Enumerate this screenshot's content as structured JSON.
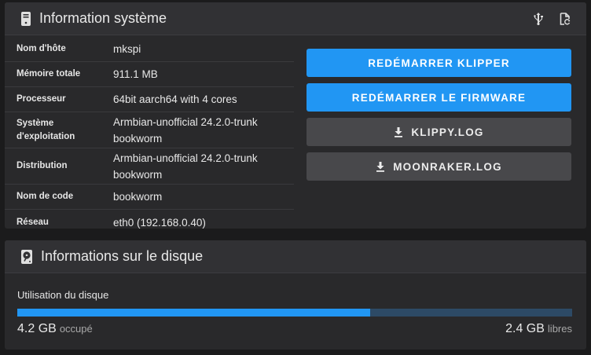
{
  "system_card": {
    "title": "Information système",
    "icon": "desktop-tower-icon",
    "header_actions": [
      "usb-icon",
      "file-refresh-icon"
    ],
    "info": [
      {
        "key": "Nom d'hôte",
        "value": "mkspi"
      },
      {
        "key": "Mémoire totale",
        "value": "911.1 MB"
      },
      {
        "key": "Processeur",
        "value": "64bit aarch64 with 4 cores"
      },
      {
        "key": "Système d'exploitation",
        "value": "Armbian-unofficial 24.2.0-trunk bookworm"
      },
      {
        "key": "Distribution",
        "value": "Armbian-unofficial 24.2.0-trunk bookworm"
      },
      {
        "key": "Nom de code",
        "value": "bookworm"
      },
      {
        "key": "Réseau",
        "value": "eth0 (192.168.0.40)"
      }
    ],
    "buttons": {
      "restart_klipper": "REDÉMARRER KLIPPER",
      "restart_firmware": "REDÉMARRER LE FIRMWARE",
      "klippy_log": "KLIPPY.LOG",
      "moonraker_log": "MOONRAKER.LOG"
    }
  },
  "disk_card": {
    "title": "Informations sur le disque",
    "icon": "harddisk-icon",
    "usage_label": "Utilisation du disque",
    "used_value": "4.2 GB",
    "used_label": "occupé",
    "free_value": "2.4 GB",
    "free_label": "libres",
    "used_fraction": 0.636
  },
  "colors": {
    "primary": "#2196f3",
    "secondary_button": "#48484b",
    "card": "#29292b",
    "bar_track": "#2d4a66"
  }
}
